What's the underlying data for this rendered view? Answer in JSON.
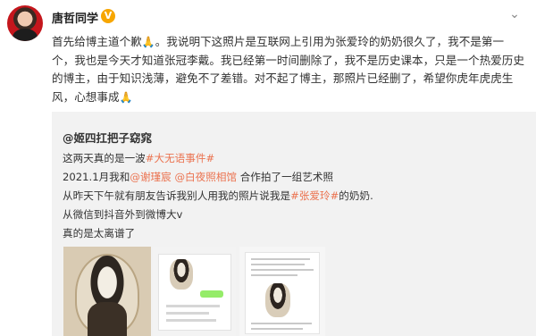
{
  "post": {
    "author": "唐哲同学",
    "badge": "V",
    "body_parts": [
      "首先给博主道个歉",
      "。我说明下这照片是互联网上引用为张爱玲的奶奶很久了，我不是第一个，我也是今天才知道张冠李戴。我已经第一时间删除了，我不是历史课本，只是一个热爱历史的博主，由于知识浅薄，避免不了差错。对不起了博主，那照片已经删了，希望你虎年虎虎生风，心想事成"
    ],
    "emoji": "🙏"
  },
  "repost": {
    "user": "@姬四扛把子窈窕",
    "line1_text": "这两天真的是一波",
    "line1_tag": "#大无语事件#",
    "line2_pre": "2021.1月我和",
    "line2_mention1": "@谢瑾宸",
    "line2_mention2": "@白夜照相馆",
    "line2_post": "合作拍了一组艺术照",
    "line3_pre": "从昨天下午就有朋友告诉我别人用我的照片说我是",
    "line3_tag": "#张爱玲#",
    "line3_post": "的奶奶.",
    "line4": "从微信到抖音外到微博大v",
    "line5": "真的是太离谱了"
  },
  "icons": {
    "more": "chevron-down-icon",
    "emoji": "praying-hands-icon"
  },
  "colors": {
    "link": "#eb7350",
    "repost_bg": "#f2f2f2",
    "badge": "#f7a600"
  }
}
